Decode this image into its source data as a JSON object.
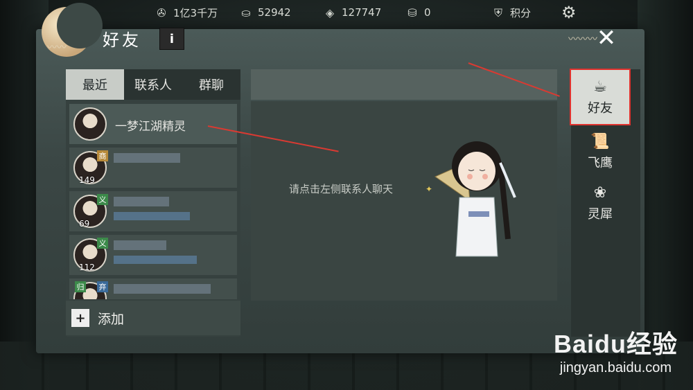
{
  "resources": [
    {
      "icon": "film-reel-icon",
      "value": "1亿3千万"
    },
    {
      "icon": "silver-ingot-icon",
      "value": "52942"
    },
    {
      "icon": "jade-ticket-icon",
      "value": "127747"
    },
    {
      "icon": "gold-ingot-icon",
      "value": "0"
    },
    {
      "icon": "shield-points-icon",
      "value": "积分"
    }
  ],
  "panel": {
    "title": "好友",
    "info_label": "i",
    "close_label": "✕"
  },
  "tabs": [
    {
      "label": "最近",
      "active": true
    },
    {
      "label": "联系人",
      "active": false
    },
    {
      "label": "群聊",
      "active": false
    }
  ],
  "contacts": [
    {
      "name": "一梦江湖精灵",
      "level": "",
      "badge": "",
      "badge2": ""
    },
    {
      "name": "",
      "level": "149",
      "badge": "商",
      "badge2": ""
    },
    {
      "name": "",
      "level": "69",
      "badge": "义",
      "badge2": ""
    },
    {
      "name": "",
      "level": "112",
      "badge": "义",
      "badge2": ""
    },
    {
      "name": "",
      "level": "",
      "badge": "归",
      "badge2": "弃"
    }
  ],
  "add_label": "添加",
  "hint": "请点击左侧联系人聊天",
  "side_tabs": [
    {
      "label": "好友",
      "icon": "teapot-icon",
      "active": true
    },
    {
      "label": "飞鹰",
      "icon": "scroll-icon",
      "active": false
    },
    {
      "label": "灵犀",
      "icon": "lingxi-icon",
      "active": false
    }
  ],
  "watermark": {
    "logo": "Baidu经验",
    "url": "jingyan.baidu.com"
  },
  "colors": {
    "accent": "#e0322e",
    "panel": "#3b4745",
    "active_tab": "#c8ccc7"
  }
}
